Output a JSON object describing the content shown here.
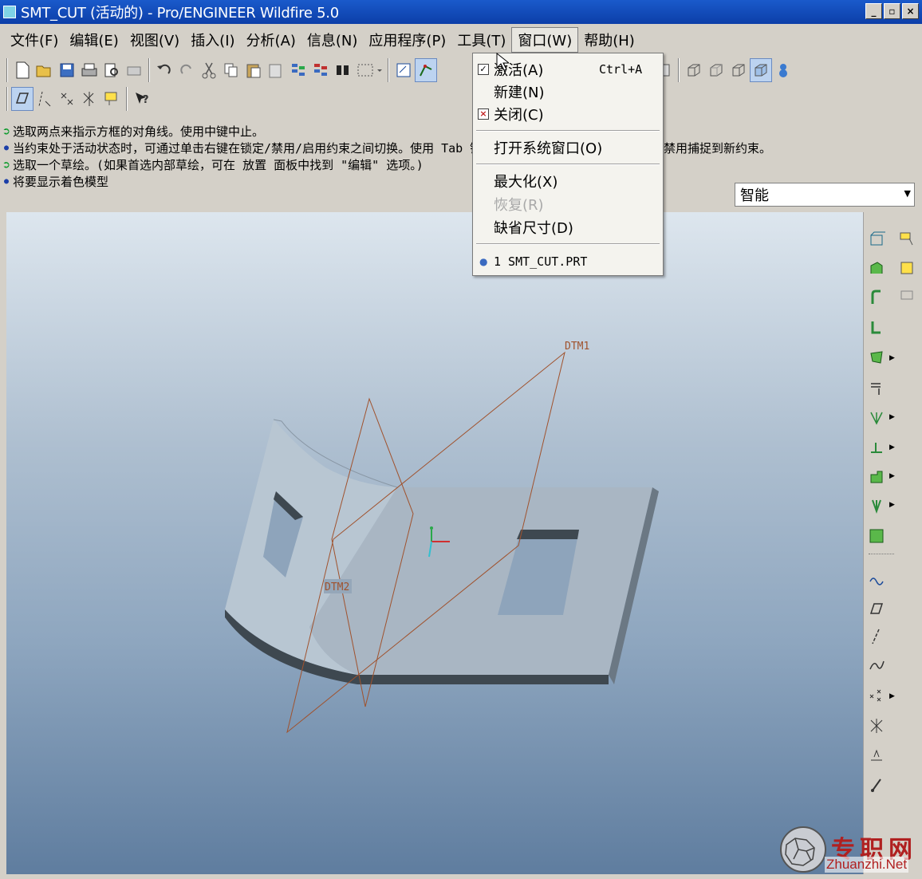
{
  "window": {
    "title": "SMT_CUT (活动的) - Pro/ENGINEER Wildfire 5.0",
    "minimize": "_",
    "maximize": "▫",
    "close": "×"
  },
  "menu": [
    "文件(F)",
    "编辑(E)",
    "视图(V)",
    "插入(I)",
    "分析(A)",
    "信息(N)",
    "应用程序(P)",
    "工具(T)",
    "窗口(W)",
    "帮助(H)"
  ],
  "messages": [
    "选取两点来指示方框的对角线。使用中键中止。",
    "当约束处于活动状态时，可通过单击右键在锁定/禁用/启用约束之间切换。使用 Tab 键",
    "禁用捕捉到新约束。",
    "选取一个草绘。(如果首选内部草绘，可在 放置 面板中找到 \"编辑\" 选项。)",
    "将要显示着色模型"
  ],
  "filter": {
    "value": "智能"
  },
  "window_menu": {
    "activate": "激活(A)",
    "activate_shortcut": "Ctrl+A",
    "new": "新建(N)",
    "close": "关闭(C)",
    "open_system_window": "打开系统窗口(O)",
    "maximize": "最大化(X)",
    "restore": "恢复(R)",
    "default_size": "缺省尺寸(D)",
    "window_1": "1 SMT_CUT.PRT"
  },
  "model": {
    "datum1": "DTM1",
    "datum2": "DTM2"
  },
  "watermark": {
    "cn": "专职网",
    "en": "Zhuanzhi.Net"
  }
}
